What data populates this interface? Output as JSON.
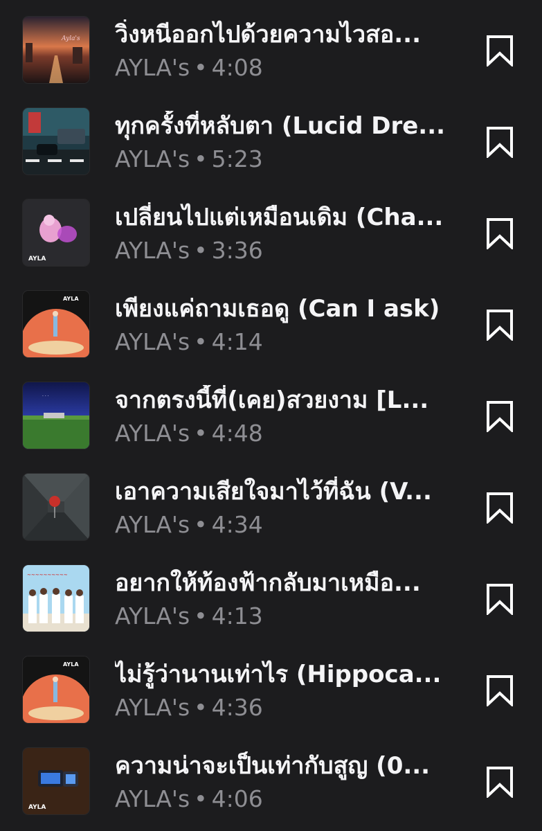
{
  "tracks": [
    {
      "title": "วิ่งหนีออกไปด้วยความไวสอ...",
      "artist": "AYLA's",
      "duration": "4:08",
      "art": "sunset-city-icon"
    },
    {
      "title": "ทุกครั้งที่หลับตา (Lucid Dre...",
      "artist": "AYLA's",
      "duration": "5:23",
      "art": "street-car-icon"
    },
    {
      "title": "เปลี่ยนไปแต่เหมือนเดิม (Cha...",
      "artist": "AYLA's",
      "duration": "3:36",
      "art": "pink-figure-icon"
    },
    {
      "title": "เพียงแค่ถามเธอดู (Can I ask)",
      "artist": "AYLA's",
      "duration": "4:14",
      "art": "orange-planet-icon"
    },
    {
      "title": "จากตรงนี้ที่(เคย)สวยงาม [L...",
      "artist": "AYLA's",
      "duration": "4:48",
      "art": "green-field-icon"
    },
    {
      "title": "เอาความเสียใจมาไว้ที่ฉัน (V...",
      "artist": "AYLA's",
      "duration": "4:34",
      "art": "red-balloon-icon"
    },
    {
      "title": "อยากให้ท้องฟ้ากลับมาเหมือ...",
      "artist": "AYLA's",
      "duration": "4:13",
      "art": "band-photo-icon"
    },
    {
      "title": "ไม่รู้ว่านานเท่าไร (Hippoca...",
      "artist": "AYLA's",
      "duration": "4:36",
      "art": "orange-planet-icon"
    },
    {
      "title": "ความน่าจะเป็นเท่ากับสูญ (0...",
      "artist": "AYLA's",
      "duration": "4:06",
      "art": "blue-device-icon"
    }
  ],
  "separator": "•",
  "colors": {
    "background": "#1c1c1e",
    "title": "#f4f4f6",
    "subtitle": "#8e8e93",
    "icon": "#ffffff"
  }
}
